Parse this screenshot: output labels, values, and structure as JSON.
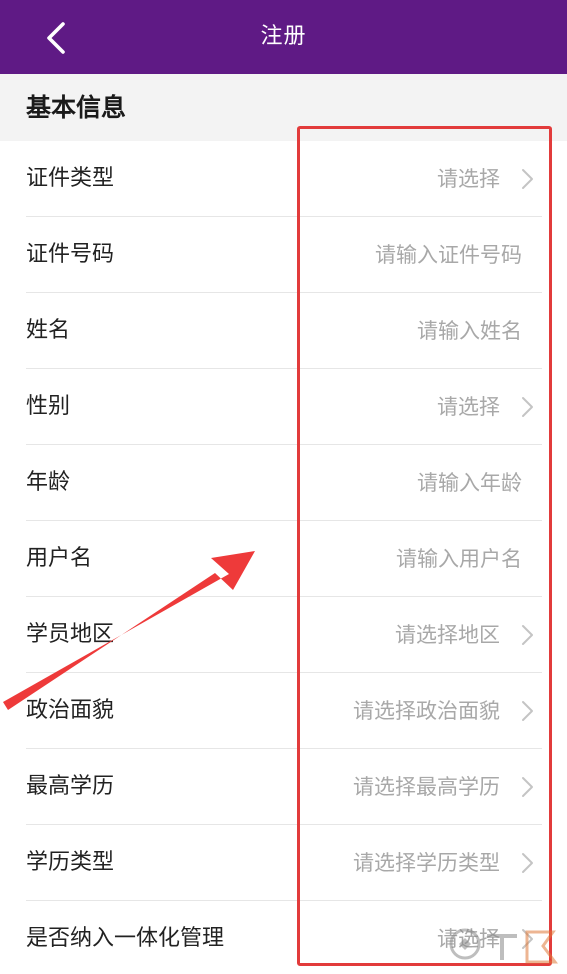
{
  "header": {
    "title": "注册",
    "back_icon": "chevron-left-icon",
    "bg_color": "#5f1a85"
  },
  "section": {
    "title": "基本信息"
  },
  "fields": [
    {
      "label": "证件类型",
      "placeholder": "请选择",
      "type": "select"
    },
    {
      "label": "证件号码",
      "placeholder": "请输入证件号码",
      "type": "input"
    },
    {
      "label": "姓名",
      "placeholder": "请输入姓名",
      "type": "input"
    },
    {
      "label": "性别",
      "placeholder": "请选择",
      "type": "select"
    },
    {
      "label": "年龄",
      "placeholder": "请输入年龄",
      "type": "input"
    },
    {
      "label": "用户名",
      "placeholder": "请输入用户名",
      "type": "input"
    },
    {
      "label": "学员地区",
      "placeholder": "请选择地区",
      "type": "select"
    },
    {
      "label": "政治面貌",
      "placeholder": "请选择政治面貌",
      "type": "select"
    },
    {
      "label": "最高学历",
      "placeholder": "请选择最高学历",
      "type": "select"
    },
    {
      "label": "学历类型",
      "placeholder": "请选择学历类型",
      "type": "select"
    },
    {
      "label": "是否纳入一体化管理",
      "placeholder": "请选择",
      "type": "select"
    }
  ],
  "annotation": {
    "box_color": "#e23b3b",
    "arrow_color": "#ee3a3a"
  },
  "watermark": {
    "icon": "site-logo-watermark"
  }
}
